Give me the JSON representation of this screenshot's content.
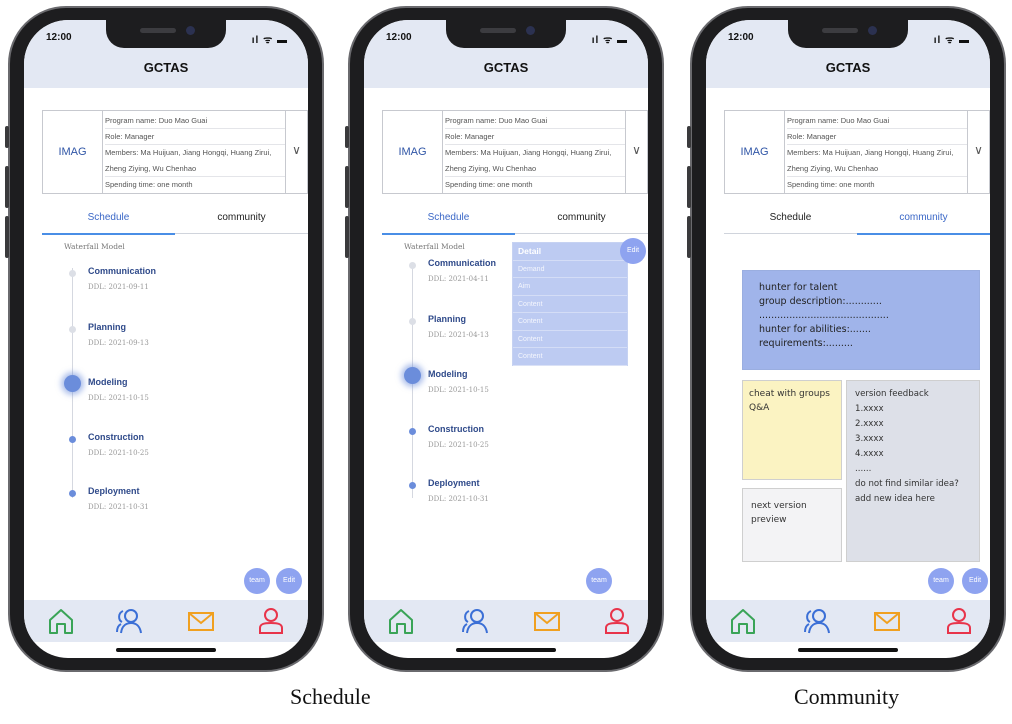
{
  "status_bar": {
    "time": "12:00",
    "indicators": "ıl ᯤ ▬"
  },
  "app": {
    "title": "GCTAS"
  },
  "program": {
    "image_label": "IMAG",
    "name": "Program name: Duo Mao Guai",
    "role": "Role: Manager",
    "members": "Members: Ma Huijuan, Jiang Hongqi, Huang Zirui, Zheng Ziying, Wu Chenhao",
    "spending": "Spending time: one month",
    "expand_icon": "chevron-down-icon"
  },
  "tabs": {
    "schedule": "Schedule",
    "community": "community"
  },
  "schedule": {
    "model": "Waterfall Model",
    "screen1_stages": [
      {
        "name": "Communication",
        "ddl": "DDL: 2021-09-11"
      },
      {
        "name": "Planning",
        "ddl": "DDL: 2021-09-13"
      },
      {
        "name": "Modeling",
        "ddl": "DDL: 2021-10-15"
      },
      {
        "name": "Construction",
        "ddl": "DDL: 2021-10-25"
      },
      {
        "name": "Deployment",
        "ddl": "DDL: 2021-10-31"
      }
    ],
    "screen2_stages": [
      {
        "name": "Communication",
        "ddl": "DDL: 2021-04-11"
      },
      {
        "name": "Planning",
        "ddl": "DDL: 2021-04-13"
      },
      {
        "name": "Modeling",
        "ddl": "DDL: 2021-10-15"
      },
      {
        "name": "Construction",
        "ddl": "DDL: 2021-10-25"
      },
      {
        "name": "Deployment",
        "ddl": "DDL: 2021-10-31"
      }
    ],
    "detail": {
      "title": "Detail",
      "items": [
        "Demand",
        "Aim",
        "Content",
        "Content",
        "Content",
        "Content"
      ]
    }
  },
  "buttons": {
    "team": "team",
    "edit": "Edit"
  },
  "community": {
    "talent": [
      "hunter for talent",
      "group description:............",
      "...........................................",
      "hunter for abilities:.......",
      "requirements:........."
    ],
    "cheat": [
      "cheat with groups",
      "Q&A"
    ],
    "feedback": [
      "version feedback",
      "1.xxxx",
      "2.xxxx",
      "3.xxxx",
      "4.xxxx",
      "......",
      "do not find similar idea?",
      "add new idea here"
    ],
    "preview": [
      "next version",
      "preview"
    ]
  },
  "bottom_nav": {
    "icons": [
      "home-icon",
      "users-icon",
      "mail-icon",
      "profile-icon"
    ],
    "colors": {
      "home": "#3aa457",
      "users": "#3b6fd6",
      "mail": "#f0a020",
      "profile": "#e8344a"
    }
  },
  "colors": {
    "accent": "#3a67c7",
    "header_bg": "#e3e8f3",
    "fab": "#8ea3f0",
    "talent_note": "#a0b4ea",
    "cheat_note": "#fbf3c2"
  },
  "captions": {
    "left": "Schedule",
    "right": "Community"
  }
}
